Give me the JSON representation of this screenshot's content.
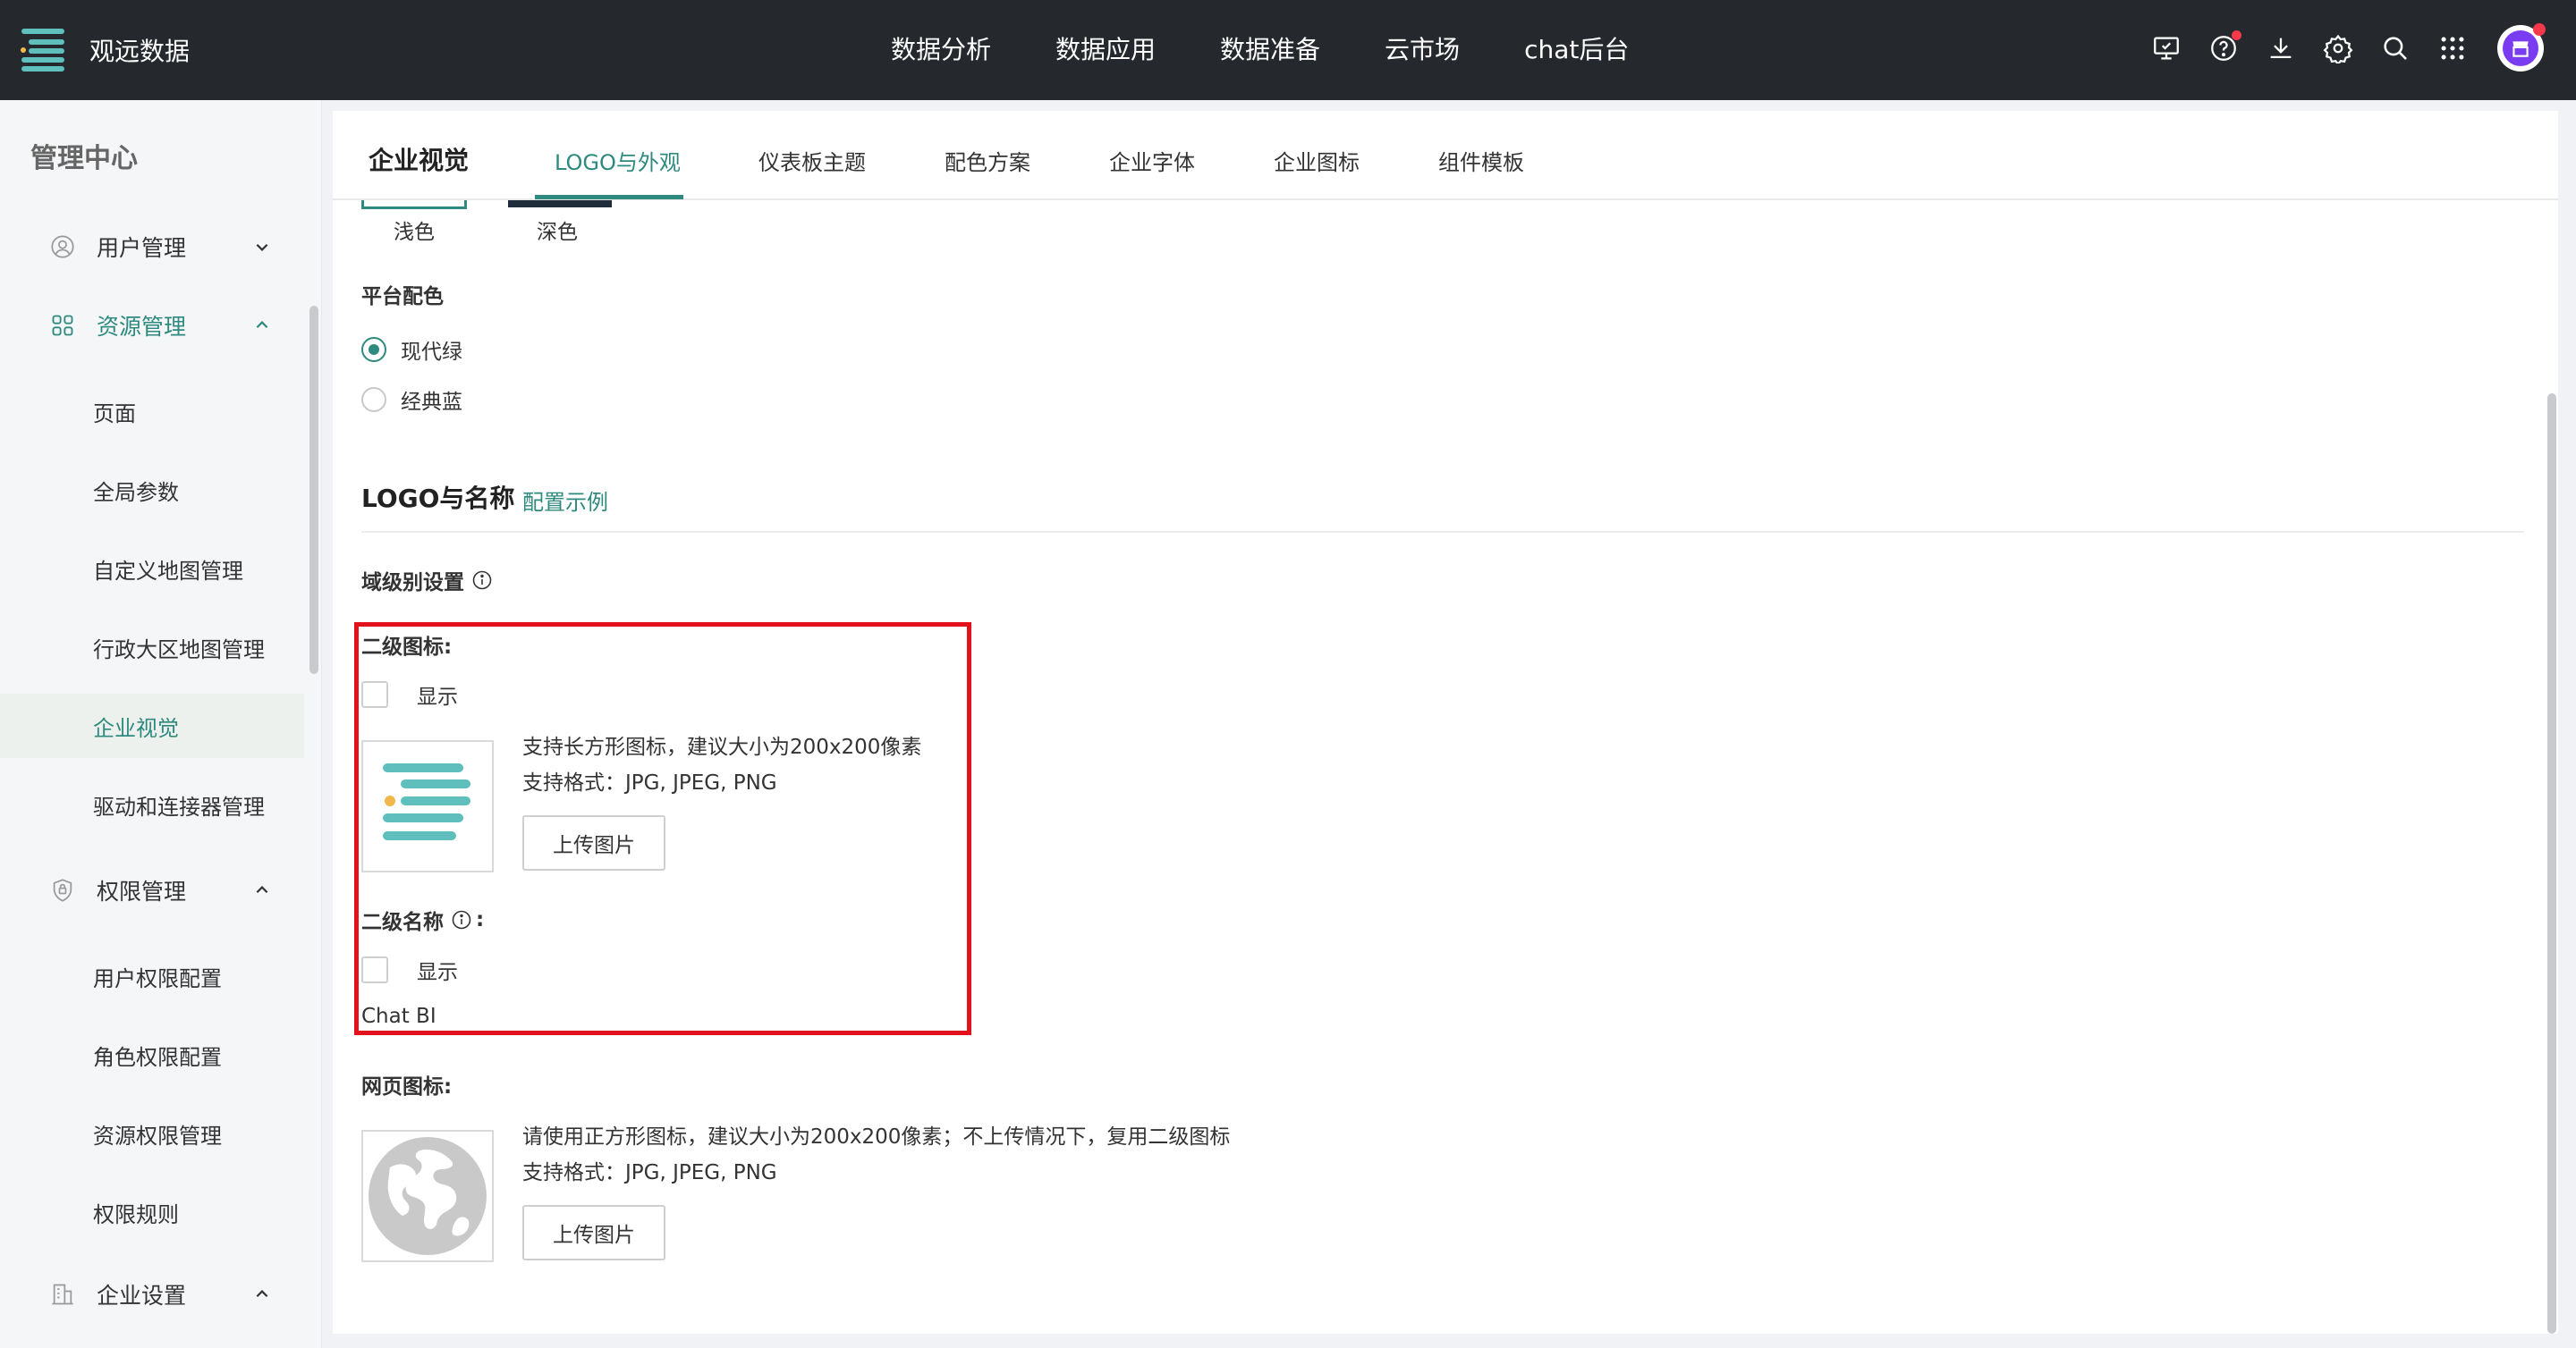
{
  "app": {
    "title": "观远数据",
    "nav": [
      "数据分析",
      "数据应用",
      "数据准备",
      "云市场",
      "chat后台"
    ]
  },
  "sidebar": {
    "title": "管理中心",
    "groups": [
      {
        "label": "用户管理",
        "icon": "user-circle-icon",
        "expanded": false
      },
      {
        "label": "资源管理",
        "icon": "grid-apps-icon",
        "expanded": true,
        "items": [
          "页面",
          "全局参数",
          "自定义地图管理",
          "行政大区地图管理",
          "企业视觉",
          "驱动和连接器管理"
        ]
      },
      {
        "label": "权限管理",
        "icon": "shield-icon",
        "expanded": true,
        "items": [
          "用户权限配置",
          "角色权限配置",
          "资源权限管理",
          "权限规则"
        ]
      },
      {
        "label": "企业设置",
        "icon": "building-icon",
        "expanded": true
      }
    ],
    "active_item": "企业视觉"
  },
  "main": {
    "title": "企业视觉",
    "tabs": [
      "LOGO与外观",
      "仪表板主题",
      "配色方案",
      "企业字体",
      "企业图标",
      "组件模板"
    ],
    "active_tab": "LOGO与外观",
    "theme": {
      "light_label": "浅色",
      "dark_label": "深色"
    },
    "platform_color": {
      "label": "平台配色",
      "options": [
        "现代绿",
        "经典蓝"
      ],
      "selected": "现代绿"
    },
    "logo_section": {
      "heading": "LOGO与名称",
      "example_link": "配置示例",
      "domain_setting": "域级别设置",
      "secondary_icon": {
        "label": "二级图标:",
        "show_label": "显示",
        "desc": "支持长方形图标，建议大小为200x200像素",
        "formats": "支持格式：JPG, JPEG, PNG",
        "upload": "上传图片"
      },
      "secondary_name": {
        "label": "二级名称",
        "colon": ":",
        "show_label": "显示",
        "value": "Chat BI"
      },
      "favicon": {
        "label": "网页图标:",
        "desc": "请使用正方形图标，建议大小为200x200像素；不上传情况下，复用二级图标",
        "formats": "支持格式：JPG, JPEG, PNG",
        "upload": "上传图片"
      }
    }
  },
  "colors": {
    "accent": "#2e8a7e",
    "topbar": "#25292e",
    "highlight": "#e3111b",
    "notification": "#f5384a"
  }
}
